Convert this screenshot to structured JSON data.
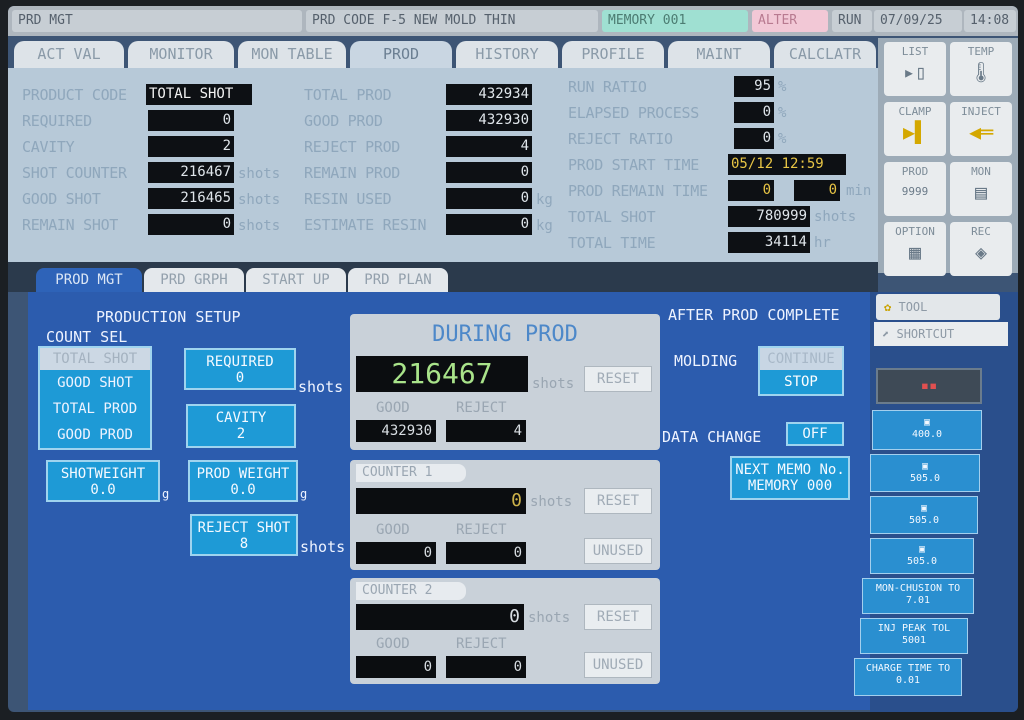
{
  "status_bar": {
    "mode": "PRD MGT",
    "product_code": "PRD CODE F-5 NEW MOLD THIN",
    "memory": "MEMORY 001",
    "alter": "ALTER",
    "run": "RUN",
    "date": "07/09/25",
    "time": "14:08"
  },
  "main_tabs": [
    "ACT VAL",
    "MONITOR",
    "MON TABLE",
    "PROD",
    "HISTORY",
    "PROFILE",
    "MAINT",
    "CALCLATR"
  ],
  "summary": {
    "col1": [
      {
        "label": "PRODUCT CODE",
        "value": "TOTAL SHOT",
        "unit": ""
      },
      {
        "label": "REQUIRED",
        "value": "0",
        "unit": ""
      },
      {
        "label": "CAVITY",
        "value": "2",
        "unit": ""
      },
      {
        "label": "SHOT COUNTER",
        "value": "216467",
        "unit": "shots"
      },
      {
        "label": "GOOD SHOT",
        "value": "216465",
        "unit": "shots"
      },
      {
        "label": "REMAIN SHOT",
        "value": "0",
        "unit": "shots"
      }
    ],
    "col2": [
      {
        "label": "TOTAL PROD",
        "value": "432934",
        "unit": ""
      },
      {
        "label": "GOOD PROD",
        "value": "432930",
        "unit": ""
      },
      {
        "label": "REJECT PROD",
        "value": "4",
        "unit": ""
      },
      {
        "label": "REMAIN PROD",
        "value": "0",
        "unit": ""
      },
      {
        "label": "RESIN USED",
        "value": "0",
        "unit": "kg"
      },
      {
        "label": "ESTIMATE RESIN",
        "value": "0",
        "unit": "kg"
      }
    ],
    "col3": [
      {
        "label": "RUN RATIO",
        "value": "95",
        "unit": "%"
      },
      {
        "label": "ELAPSED PROCESS",
        "value": "0",
        "unit": "%"
      },
      {
        "label": "REJECT RATIO",
        "value": "0",
        "unit": "%"
      },
      {
        "label": "PROD START TIME",
        "value": "05/12 12:59",
        "unit": ""
      },
      {
        "label": "PROD REMAIN TIME",
        "value": "0",
        "value2": "0",
        "unit": "min"
      },
      {
        "label": "TOTAL SHOT",
        "value": "780999",
        "unit": "shots"
      },
      {
        "label": "TOTAL TIME",
        "value": "34114",
        "unit": "hr"
      }
    ]
  },
  "side_menu": [
    {
      "label": "LIST",
      "icon": "list-icon"
    },
    {
      "label": "TEMP",
      "icon": "thermometer-icon"
    },
    {
      "label": "CLAMP",
      "icon": "clamp-icon"
    },
    {
      "label": "INJECT",
      "icon": "inject-icon"
    },
    {
      "label": "PROD",
      "sub": "9999",
      "icon": "prod-icon"
    },
    {
      "label": "MON",
      "icon": "monitor-icon"
    },
    {
      "label": "OPTION",
      "icon": "option-icon"
    },
    {
      "label": "REC",
      "icon": "record-icon"
    }
  ],
  "sub_tabs": [
    "PROD MGT",
    "PRD GRPH",
    "START UP",
    "PRD PLAN"
  ],
  "production_setup": {
    "title": "PRODUCTION SETUP",
    "count_sel_label": "COUNT SEL",
    "count_options": [
      "TOTAL SHOT",
      "GOOD SHOT",
      "TOTAL PROD",
      "GOOD PROD"
    ],
    "shot_weight": {
      "label": "SHOTWEIGHT",
      "value": "0.0",
      "unit": "g"
    },
    "required": {
      "label": "REQUIRED",
      "value": "0",
      "unit": "shots"
    },
    "cavity": {
      "label": "CAVITY",
      "value": "2"
    },
    "prod_weight": {
      "label": "PROD WEIGHT",
      "value": "0.0",
      "unit": "g"
    },
    "reject_shot": {
      "label": "REJECT SHOT",
      "value": "8",
      "unit": "shots"
    }
  },
  "during_prod": {
    "title": "DURING PROD",
    "count": "216467",
    "unit": "shots",
    "reset": "RESET",
    "good_label": "GOOD",
    "reject_label": "REJECT",
    "good": "432930",
    "reject": "4"
  },
  "counter1": {
    "title": "COUNTER 1",
    "count": "0",
    "unit": "shots",
    "reset": "RESET",
    "good_label": "GOOD",
    "reject_label": "REJECT",
    "good": "0",
    "reject": "0",
    "status": "UNUSED"
  },
  "counter2": {
    "title": "COUNTER 2",
    "count": "0",
    "unit": "shots",
    "reset": "RESET",
    "good_label": "GOOD",
    "reject_label": "REJECT",
    "good": "0",
    "reject": "0",
    "status": "UNUSED"
  },
  "after_prod": {
    "title": "AFTER PROD COMPLETE",
    "molding_label": "MOLDING",
    "continue_label": "CONTINUE",
    "stop_label": "STOP",
    "data_change_label": "DATA CHANGE",
    "data_change_value": "OFF",
    "next_memo": "NEXT MEMO No.",
    "memory": "MEMORY 000"
  },
  "right_panel": {
    "tool": "TOOL",
    "shortcut": "SHORTCUT",
    "buttons": [
      "400.0",
      "505.0",
      "505.0",
      "505.0",
      "MON-CHUSION TO 7.01",
      "INJ PEAK TOL 5001",
      "CHARGE TIME TO 0.01"
    ]
  }
}
